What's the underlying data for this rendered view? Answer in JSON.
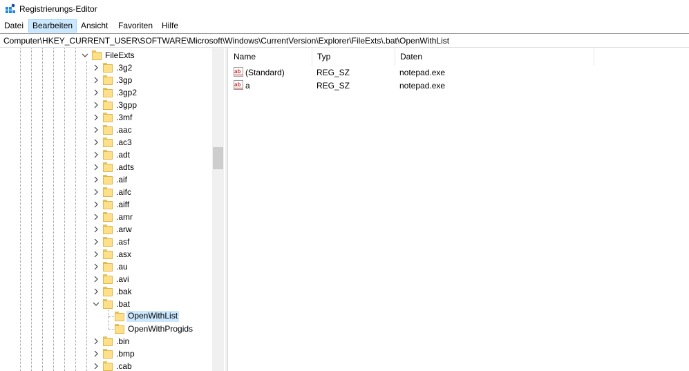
{
  "window": {
    "title": "Registrierungs-Editor",
    "icon": "regedit-icon"
  },
  "menu": {
    "items": [
      "Datei",
      "Bearbeiten",
      "Ansicht",
      "Favoriten",
      "Hilfe"
    ],
    "active": "Bearbeiten"
  },
  "address": {
    "path": "Computer\\HKEY_CURRENT_USER\\SOFTWARE\\Microsoft\\Windows\\CurrentVersion\\Explorer\\FileExts\\.bat\\OpenWithList"
  },
  "tree": {
    "parent": "FileExts",
    "items": [
      ".3g2",
      ".3gp",
      ".3gp2",
      ".3gpp",
      ".3mf",
      ".aac",
      ".ac3",
      ".adt",
      ".adts",
      ".aif",
      ".aifc",
      ".aiff",
      ".amr",
      ".arw",
      ".asf",
      ".asx",
      ".au",
      ".avi",
      ".bak",
      ".bat"
    ],
    "expanded_item": ".bat",
    "children": [
      "OpenWithList",
      "OpenWithProgids"
    ],
    "selected": "OpenWithList",
    "after_items": [
      ".bin",
      ".bmp",
      ".cab"
    ]
  },
  "list": {
    "columns": [
      "Name",
      "Typ",
      "Daten"
    ],
    "rows": [
      {
        "name": "(Standard)",
        "type": "REG_SZ",
        "data": "notepad.exe",
        "icon": "string-value-icon"
      },
      {
        "name": "a",
        "type": "REG_SZ",
        "data": "notepad.exe",
        "icon": "string-value-icon"
      }
    ]
  },
  "colors": {
    "selection": "#cce8ff",
    "folder": "#ffe08a"
  }
}
